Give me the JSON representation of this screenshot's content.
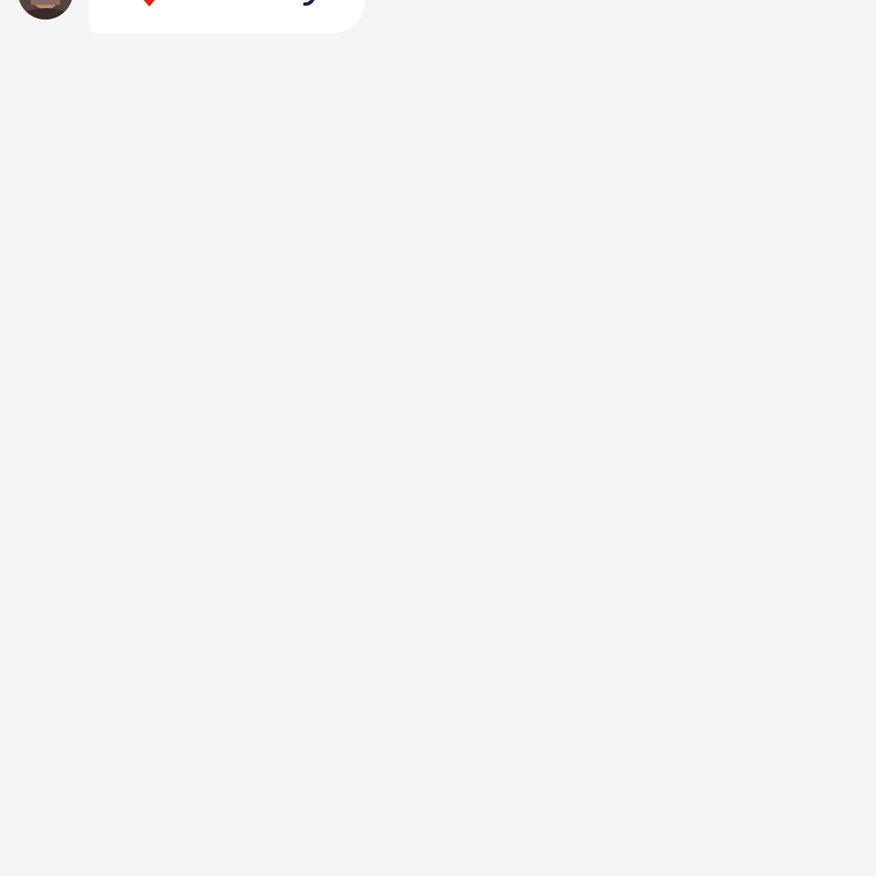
{
  "chat": {
    "messages": [
      {
        "sender_avatar": "avatar-photo",
        "emoji": "heart-icon",
        "text": "Love ya!"
      }
    ]
  },
  "colors": {
    "background": "#f4f4f7",
    "bubble": "#ffffff",
    "text": "#231a52",
    "heart": "#e8201a"
  }
}
